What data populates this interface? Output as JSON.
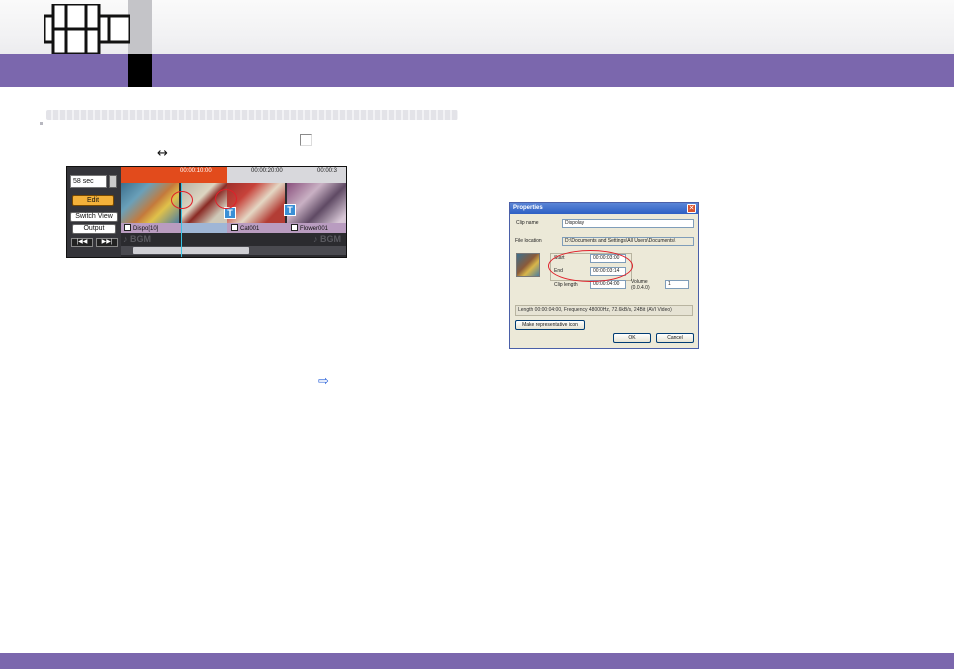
{
  "colors": {
    "accent": "#7b67ad",
    "highlight_circle": "#e0202a",
    "link_arrow": "#2b63d9"
  },
  "icons": {
    "header": "film-strip-icon",
    "resize": "left-right-arrow-icon",
    "link": "right-arrow-icon",
    "checkbox": "checkbox-icon"
  },
  "timeline": {
    "duration_field": "58 sec",
    "buttons": {
      "edit": "Edit",
      "switch_view": "Switch View",
      "output": "Output",
      "prev": "|◀◀",
      "next": "▶▶|"
    },
    "ruler_times": [
      "00:00:10:00",
      "00:00:20:00",
      "00:00:3"
    ],
    "clip_labels": [
      "Dispo[10]",
      "Cat001",
      "Flower001"
    ],
    "bgm_label": "♪ BGM",
    "text_icon_glyph": "T"
  },
  "dialog": {
    "title": "Properties",
    "close_glyph": "✕",
    "clip_name_label": "Clip name",
    "clip_name_value": "Dispolay",
    "file_location_label": "File location",
    "file_location_value": "D:\\Documents and Settings\\All Users\\Documents\\",
    "start_label": "Start",
    "start_value": "00:00:03:00",
    "end_label": "End",
    "end_value": "00:00:03:14",
    "clip_length_label": "Clip length",
    "clip_length_value": "00:00:04:00",
    "volume_label": "Volume (0.0.4.0)",
    "volume_value": "1",
    "info_line": "Length 00:00:04:00, Frequency 48000Hz, 72.6kB/s, 24Bit (AVI Video)",
    "make_button": "Make representative icon",
    "ok_button": "OK",
    "cancel_button": "Cancel"
  }
}
